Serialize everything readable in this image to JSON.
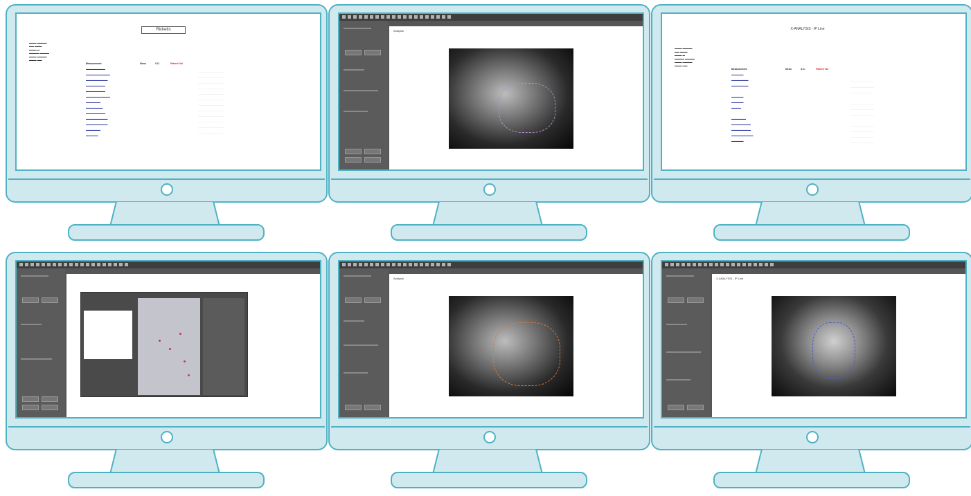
{
  "monitors": [
    {
      "id": "m1",
      "screen": "report",
      "title": "Ricketts"
    },
    {
      "id": "m2",
      "screen": "software",
      "view": "Analysis"
    },
    {
      "id": "m3",
      "screen": "report",
      "title": "X-ANALYSIS - IP Line"
    },
    {
      "id": "m4",
      "screen": "software-dialog"
    },
    {
      "id": "m5",
      "screen": "software",
      "view": "Analysis"
    },
    {
      "id": "m6",
      "screen": "software",
      "view": "X-ANALYSIS - IP Line"
    }
  ],
  "report": {
    "headers": {
      "measurement": "Measurement",
      "mean": "Mean",
      "sd": "S.D.",
      "value": "Patient Val",
      "deviation": "±"
    }
  },
  "colors": {
    "frame": "#4fb2c4",
    "frame_fill": "#cfe9ee",
    "app_dark": "#3e3e3e",
    "red": "#d12020"
  }
}
